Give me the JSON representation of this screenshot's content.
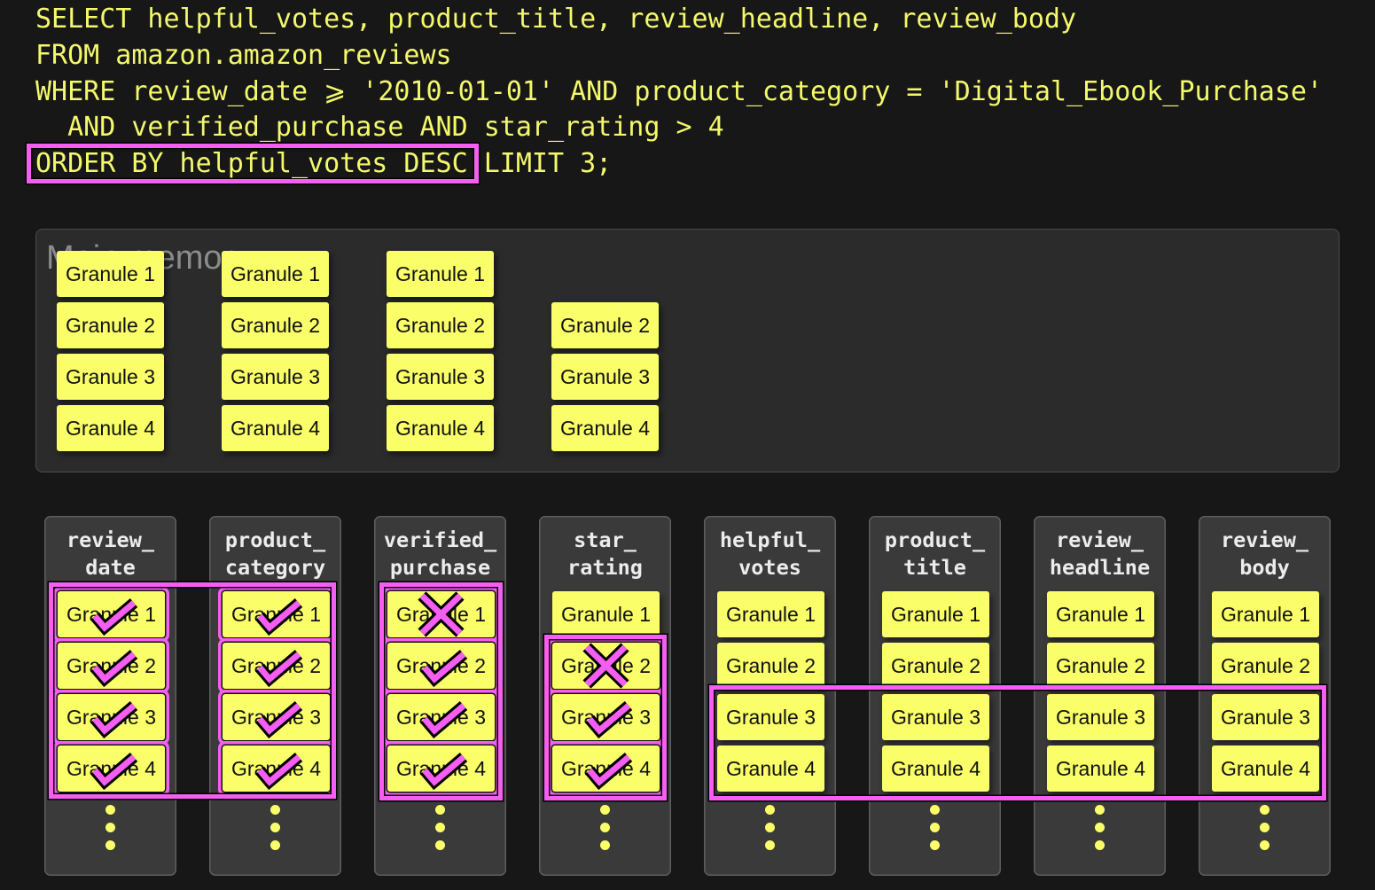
{
  "sql": {
    "lines": [
      "SELECT helpful_votes, product_title, review_headline, review_body",
      "FROM amazon.amazon_reviews",
      "WHERE review_date ⩾ '2010-01-01' AND product_category = 'Digital_Ebook_Purchase'",
      "  AND verified_purchase AND star_rating > 4"
    ],
    "order_by": "ORDER BY helpful_votes DESC",
    "limit": "LIMIT 3;"
  },
  "main_memory": {
    "label": "Main memory",
    "columns": [
      [
        "Granule 1",
        "Granule 2",
        "Granule 3",
        "Granule 4"
      ],
      [
        "Granule 1",
        "Granule 2",
        "Granule 3",
        "Granule 4"
      ],
      [
        "Granule 1",
        "Granule 2",
        "Granule 3",
        "Granule 4"
      ],
      [
        null,
        "Granule 2",
        "Granule 3",
        "Granule 4"
      ]
    ]
  },
  "columns": [
    {
      "header": [
        "review_",
        "date"
      ],
      "granules": [
        {
          "label": "Granule 1",
          "mark": "check-icon"
        },
        {
          "label": "Granule 2",
          "mark": "check-icon"
        },
        {
          "label": "Granule 3",
          "mark": "check-icon"
        },
        {
          "label": "Granule 4",
          "mark": "check-icon"
        }
      ]
    },
    {
      "header": [
        "product_",
        "category"
      ],
      "granules": [
        {
          "label": "Granule 1",
          "mark": "check-icon"
        },
        {
          "label": "Granule 2",
          "mark": "check-icon"
        },
        {
          "label": "Granule 3",
          "mark": "check-icon"
        },
        {
          "label": "Granule 4",
          "mark": "check-icon"
        }
      ]
    },
    {
      "header": [
        "verified_",
        "purchase"
      ],
      "granules": [
        {
          "label": "Granule 1",
          "mark": "cross-icon"
        },
        {
          "label": "Granule 2",
          "mark": "check-icon"
        },
        {
          "label": "Granule 3",
          "mark": "check-icon"
        },
        {
          "label": "Granule 4",
          "mark": "check-icon"
        }
      ]
    },
    {
      "header": [
        "star_",
        "rating"
      ],
      "granules": [
        {
          "label": "Granule 1",
          "mark": ""
        },
        {
          "label": "Granule 2",
          "mark": "cross-icon"
        },
        {
          "label": "Granule 3",
          "mark": "check-icon"
        },
        {
          "label": "Granule 4",
          "mark": "check-icon"
        }
      ]
    },
    {
      "header": [
        "helpful_",
        "votes"
      ],
      "granules": [
        {
          "label": "Granule 1",
          "mark": ""
        },
        {
          "label": "Granule 2",
          "mark": ""
        },
        {
          "label": "Granule 3",
          "mark": ""
        },
        {
          "label": "Granule 4",
          "mark": ""
        }
      ]
    },
    {
      "header": [
        "product_",
        "title"
      ],
      "granules": [
        {
          "label": "Granule 1",
          "mark": ""
        },
        {
          "label": "Granule 2",
          "mark": ""
        },
        {
          "label": "Granule 3",
          "mark": ""
        },
        {
          "label": "Granule 4",
          "mark": ""
        }
      ]
    },
    {
      "header": [
        "review_",
        "headline"
      ],
      "granules": [
        {
          "label": "Granule 1",
          "mark": ""
        },
        {
          "label": "Granule 2",
          "mark": ""
        },
        {
          "label": "Granule 3",
          "mark": ""
        },
        {
          "label": "Granule 4",
          "mark": ""
        }
      ]
    },
    {
      "header": [
        "review_",
        "body"
      ],
      "granules": [
        {
          "label": "Granule 1",
          "mark": ""
        },
        {
          "label": "Granule 2",
          "mark": ""
        },
        {
          "label": "Granule 3",
          "mark": ""
        },
        {
          "label": "Granule 4",
          "mark": ""
        }
      ]
    }
  ],
  "colors": {
    "granule": "#faff69",
    "highlight": "#f65ef2",
    "code_text": "#f4f86b",
    "background": "#171717"
  }
}
